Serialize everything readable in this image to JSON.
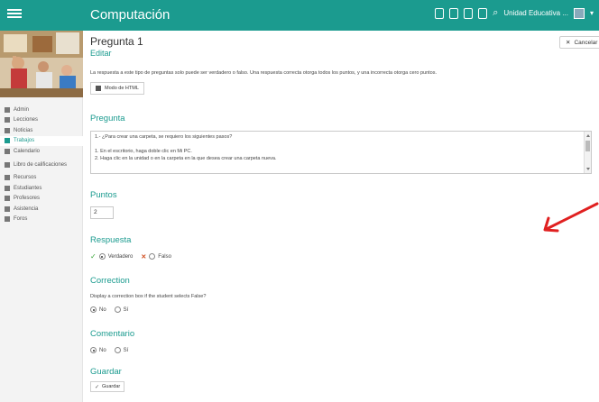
{
  "topbar": {
    "course": "Computación",
    "school": "Unidad Educativa ..."
  },
  "sidebar": {
    "items": [
      {
        "label": "Admin",
        "icon": "gear-icon",
        "active": false
      },
      {
        "label": "Lecciones",
        "icon": "book-icon",
        "active": false
      },
      {
        "label": "Noticias",
        "icon": "megaphone-icon",
        "active": false
      },
      {
        "label": "Trabajos",
        "icon": "document-icon",
        "active": true
      },
      {
        "label": "Calendario",
        "icon": "calendar-icon",
        "active": false
      },
      {
        "label": "Libro de calificaciones",
        "icon": "gradebook-icon",
        "active": false
      },
      {
        "label": "Recursos",
        "icon": "resources-icon",
        "active": false
      },
      {
        "label": "Estudiantes",
        "icon": "student-icon",
        "active": false
      },
      {
        "label": "Profesores",
        "icon": "teacher-icon",
        "active": false
      },
      {
        "label": "Asistencia",
        "icon": "attendance-icon",
        "active": false
      },
      {
        "label": "Foros",
        "icon": "forum-icon",
        "active": false
      }
    ]
  },
  "main": {
    "title": "Pregunta 1",
    "subtitle": "Editar",
    "cancel_label": "Cancelar",
    "description": "La respuesta a este tipo de preguntas solo puede ser verdadero o falso. Una respuesta correcta otorga todos los puntos, y una incorrecta otorga cero puntos.",
    "html_mode_label": "Modo de HTML",
    "question_heading": "Pregunta",
    "question_lines": [
      "1.- ¿Para crear una carpeta, se requiero los siguientes pasos?",
      "",
      "1.    En el escritorio, haga doble clic en Mi PC.",
      "2.    Haga clic en la unidad o en la carpeta en la que desea crear una carpeta nueva."
    ],
    "points_heading": "Puntos",
    "points_value": "2",
    "answer_heading": "Respuesta",
    "answer_true": "Verdadero",
    "answer_false": "Falso",
    "answer_selected": "Verdadero",
    "correction_heading": "Correction",
    "correction_desc": "Display a correction box if the student selects False?",
    "correction_no": "No",
    "correction_yes": "Sí",
    "comment_heading": "Comentario",
    "comment_no": "No",
    "comment_yes": "Sí",
    "save_heading": "Guardar",
    "save_label": "Guardar"
  },
  "colors": {
    "brand": "#1b9b8f",
    "annotation_arrow": "#e02020"
  }
}
